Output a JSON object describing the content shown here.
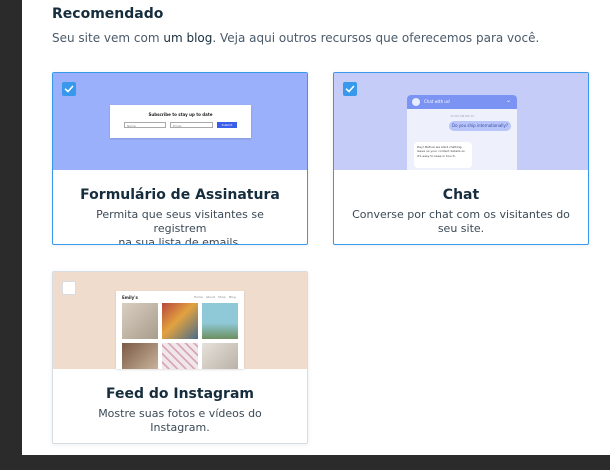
{
  "section": {
    "title": "Recomendado",
    "subtitle_prefix": "Seu site vem com ",
    "subtitle_link": "um blog",
    "subtitle_suffix": ". Veja aqui outros recursos que oferecemos para você."
  },
  "cards": [
    {
      "title": "Formulário de Assinatura",
      "desc_line1": "Permita que seus visitantes se registrem",
      "desc_line2": "na sua lista de emails.",
      "selected": true,
      "banner_color": "#9bb0fb",
      "preview": {
        "form_title": "Subscribe to stay up to date",
        "field1_placeholder": "Name",
        "field2_placeholder": "Email",
        "button_label": "Submit"
      }
    },
    {
      "title": "Chat",
      "desc_line1": "Converse por chat com os visitantes do",
      "desc_line2": "seu site.",
      "selected": true,
      "banner_color": "#c4ccf7",
      "preview": {
        "header_title": "Chat with us!",
        "timestamp": "12:00 AM 08:13",
        "question": "Do you ship internationally?",
        "answer": "Hey! Before we start chatting, leave us your contact details so it's easy to keep in touch."
      }
    },
    {
      "title": "Feed do Instagram",
      "desc_line1": "Mostre suas fotos e vídeos do Instagram.",
      "desc_line2": "",
      "selected": false,
      "banner_color": "#efdccd",
      "preview": {
        "brand": "Emily's",
        "nav": [
          "Home",
          "About",
          "Shop",
          "Blog"
        ]
      }
    }
  ],
  "colors": {
    "accent": "#3899ec",
    "heading": "#162d3d",
    "text": "#3b4a57"
  },
  "icons": {
    "check": "checkmark-icon"
  }
}
